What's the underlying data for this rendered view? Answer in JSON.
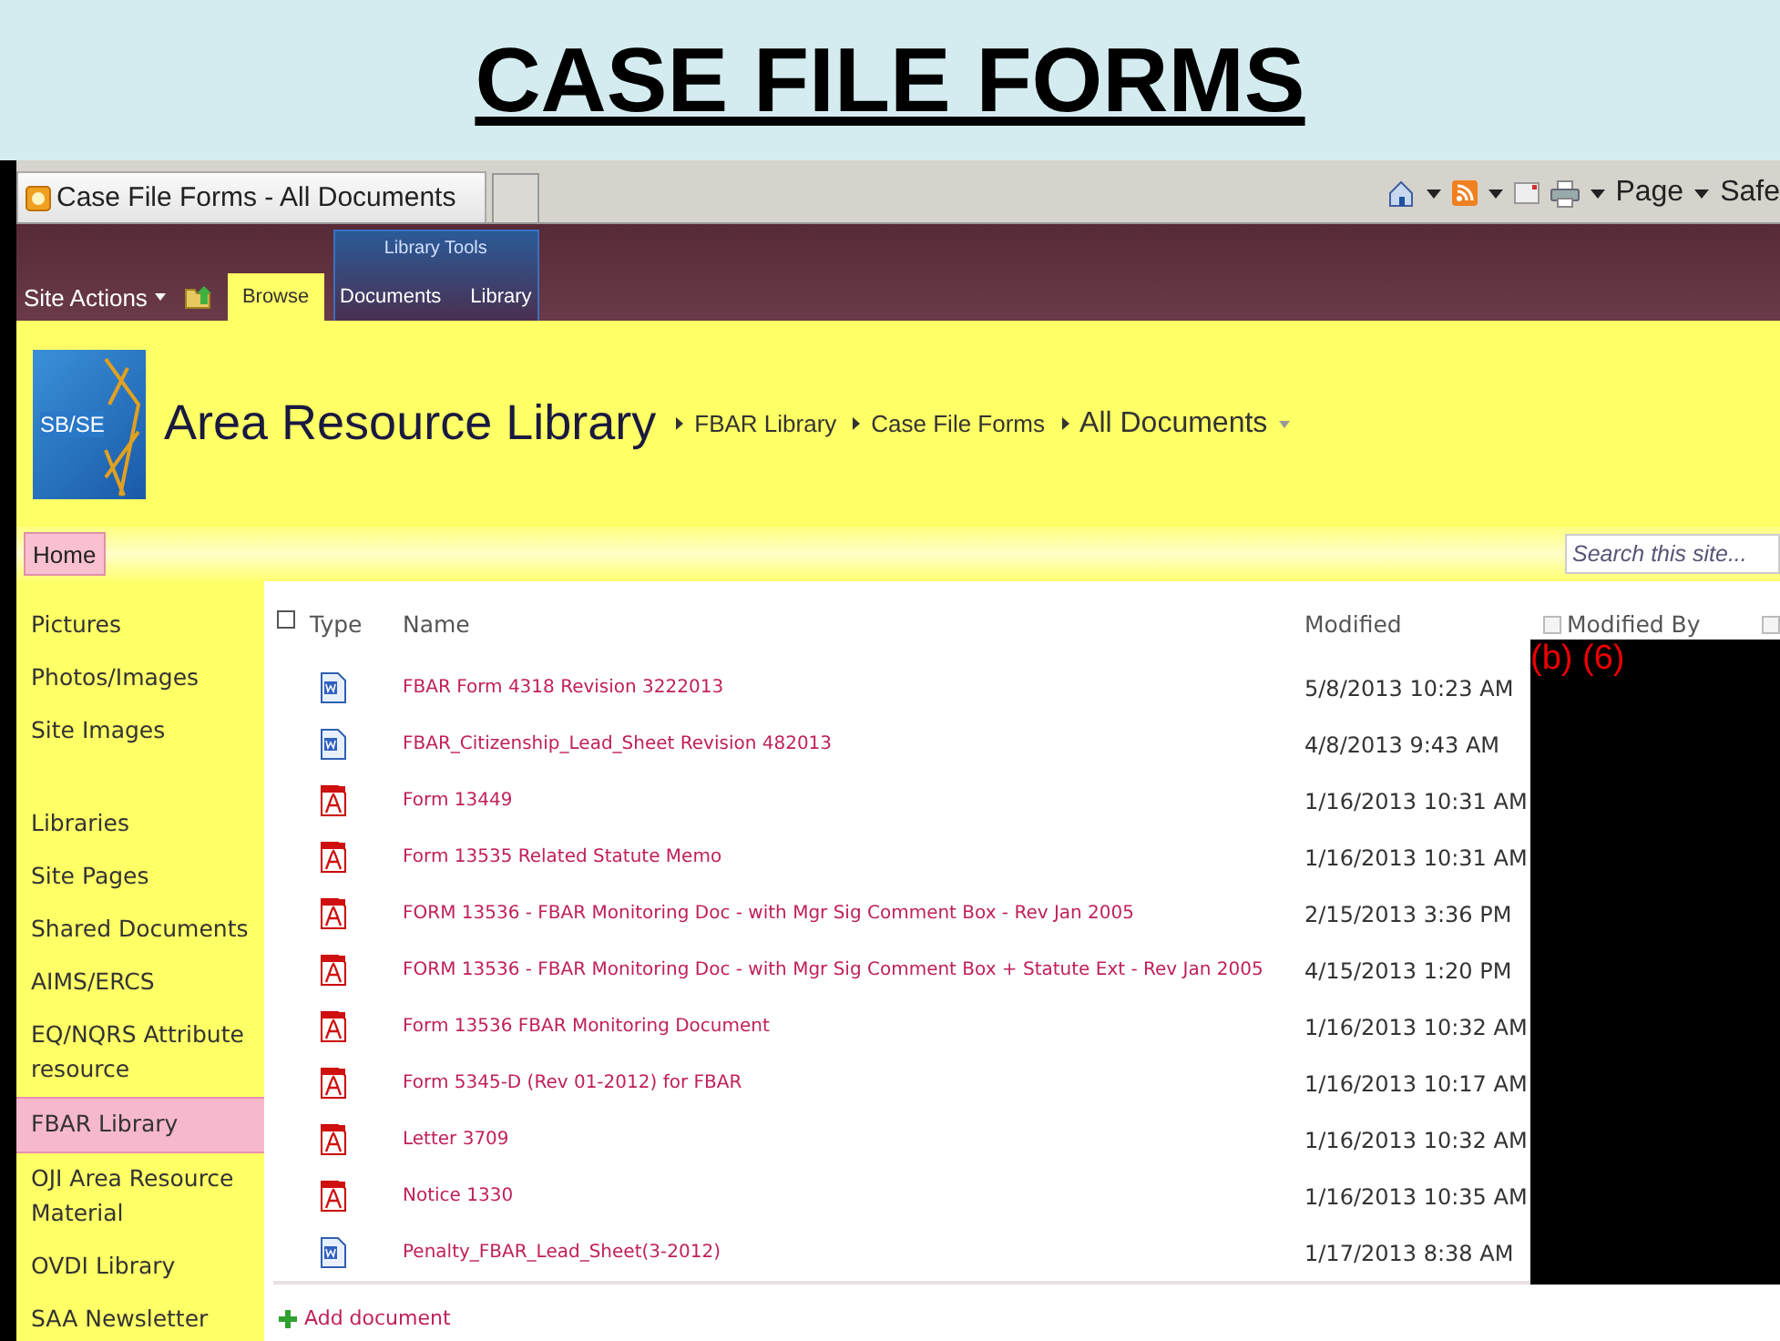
{
  "slide_title": "CASE FILE FORMS",
  "browser": {
    "tab_title": "Case File Forms - All Documents",
    "page_menu": "Page",
    "safety_menu": "Safe"
  },
  "ribbon": {
    "site_actions": "Site Actions",
    "tool_group": "Library Tools",
    "tabs": [
      {
        "label": "Browse",
        "selected": true
      },
      {
        "label": "Documents",
        "selected": false
      },
      {
        "label": "Library",
        "selected": false
      }
    ]
  },
  "header": {
    "logo_text": "SB/SE",
    "site_title": "Area Resource Library",
    "breadcrumb": [
      "FBAR Library",
      "Case File Forms",
      "All Documents"
    ]
  },
  "top_nav": [
    {
      "label": "Home",
      "selected": true
    }
  ],
  "search": {
    "placeholder": "Search this site..."
  },
  "sidebar": [
    {
      "kind": "heading",
      "label": "Pictures",
      "selected": false
    },
    {
      "kind": "link",
      "label": "Photos/Images",
      "selected": false
    },
    {
      "kind": "link",
      "label": "Site Images",
      "selected": false
    },
    {
      "kind": "heading",
      "label": "Libraries",
      "selected": false
    },
    {
      "kind": "link",
      "label": "Site Pages",
      "selected": false
    },
    {
      "kind": "link",
      "label": "Shared Documents",
      "selected": false
    },
    {
      "kind": "link",
      "label": "AIMS/ERCS",
      "selected": false
    },
    {
      "kind": "link",
      "label": "EQ/NQRS Attribute resource",
      "selected": false
    },
    {
      "kind": "link",
      "label": "FBAR Library",
      "selected": true
    },
    {
      "kind": "link",
      "label": "OJI Area Resource Material",
      "selected": false
    },
    {
      "kind": "link",
      "label": "OVDI Library",
      "selected": false
    },
    {
      "kind": "link",
      "label": "SAA Newsletter",
      "selected": false
    }
  ],
  "table": {
    "select_all": {
      "checked": false
    },
    "column_checks": [
      {
        "checked": false
      },
      {
        "checked": false
      }
    ],
    "columns": [
      "Type",
      "Name",
      "Modified",
      "Modified By"
    ],
    "rows": [
      {
        "kind": "word",
        "name": "FBAR Form 4318 Revision 3222013",
        "modified": "5/8/2013 10:23 AM"
      },
      {
        "kind": "word",
        "name": "FBAR_Citizenship_Lead_Sheet Revision 482013",
        "modified": "4/8/2013 9:43 AM"
      },
      {
        "kind": "pdf",
        "name": "Form 13449",
        "modified": "1/16/2013 10:31 AM"
      },
      {
        "kind": "pdf",
        "name": "Form 13535 Related Statute Memo",
        "modified": "1/16/2013 10:31 AM"
      },
      {
        "kind": "pdf",
        "name": "FORM 13536 - FBAR Monitoring Doc - with Mgr Sig Comment Box - Rev Jan 2005",
        "modified": "2/15/2013 3:36 PM"
      },
      {
        "kind": "pdf",
        "name": "FORM 13536 - FBAR Monitoring Doc - with Mgr Sig Comment Box + Statute Ext - Rev Jan 2005",
        "modified": "4/15/2013 1:20 PM"
      },
      {
        "kind": "pdf",
        "name": "Form 13536 FBAR Monitoring Document",
        "modified": "1/16/2013 10:32 AM"
      },
      {
        "kind": "pdf",
        "name": "Form 5345-D (Rev 01-2012) for FBAR",
        "modified": "1/16/2013 10:17 AM"
      },
      {
        "kind": "pdf",
        "name": "Letter 3709",
        "modified": "1/16/2013 10:32 AM"
      },
      {
        "kind": "pdf",
        "name": "Notice 1330",
        "modified": "1/16/2013 10:35 AM"
      },
      {
        "kind": "word",
        "name": "Penalty_FBAR_Lead_Sheet(3-2012)",
        "modified": "1/17/2013 8:38 AM"
      }
    ],
    "redaction": "(b) (6)"
  },
  "add_document": "Add document"
}
